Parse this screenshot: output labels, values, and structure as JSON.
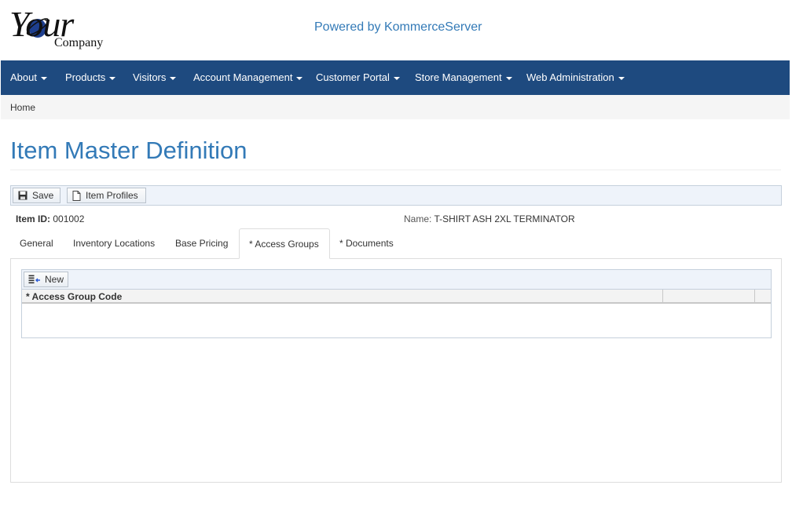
{
  "header": {
    "logo_text_main": "Your",
    "logo_text_sub": "Company",
    "powered_by": "Powered by KommerceServer"
  },
  "nav": {
    "items": [
      {
        "label": "About"
      },
      {
        "label": "Products"
      },
      {
        "label": "Visitors"
      },
      {
        "label": "Account Management"
      },
      {
        "label": "Customer Portal"
      },
      {
        "label": "Store Management"
      },
      {
        "label": "Web Administration"
      }
    ]
  },
  "breadcrumb": {
    "home": "Home"
  },
  "page": {
    "title": "Item Master Definition"
  },
  "toolbar": {
    "save_label": "Save",
    "item_profiles_label": "Item Profiles"
  },
  "item": {
    "id_label": "Item ID:",
    "id_value": "001002",
    "name_label": "Name:",
    "name_value": "T-SHIRT ASH 2XL TERMINATOR"
  },
  "tabs": [
    {
      "label": "General",
      "active": false
    },
    {
      "label": "Inventory Locations",
      "active": false
    },
    {
      "label": "Base Pricing",
      "active": false
    },
    {
      "label": "* Access Groups",
      "active": true
    },
    {
      "label": "* Documents",
      "active": false
    }
  ],
  "grid": {
    "new_label": "New",
    "columns": [
      "* Access Group Code",
      "",
      ""
    ],
    "rows": []
  },
  "colors": {
    "navbar": "#1e4a7f",
    "title": "#337ab7",
    "link": "#337ab7"
  }
}
